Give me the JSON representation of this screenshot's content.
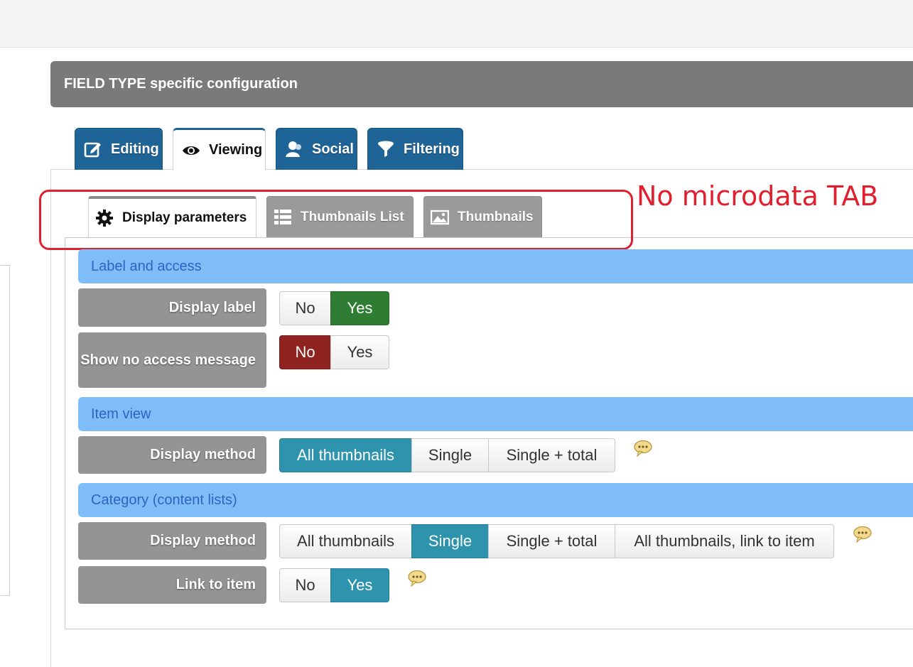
{
  "header": {
    "title": "FIELD TYPE specific configuration"
  },
  "main_tabs": [
    {
      "label": "Editing",
      "icon": "edit-icon",
      "active": false
    },
    {
      "label": "Viewing",
      "icon": "eye-icon",
      "active": true
    },
    {
      "label": "Social",
      "icon": "users-icon",
      "active": false
    },
    {
      "label": "Filtering",
      "icon": "filter-icon",
      "active": false
    }
  ],
  "sub_tabs": [
    {
      "label": "Display parameters",
      "icon": "gear-icon",
      "active": true
    },
    {
      "label": "Thumbnails List",
      "icon": "list-icon",
      "active": false
    },
    {
      "label": "Thumbnails",
      "icon": "image-icon",
      "active": false
    }
  ],
  "annotation": {
    "text": "No microdata TAB",
    "color": "#e0202e"
  },
  "sections": {
    "label_access": {
      "title": "Label and access",
      "display_label": {
        "label": "Display label",
        "options": [
          "No",
          "Yes"
        ],
        "selected": "Yes"
      },
      "show_no_access": {
        "label": "Show no access message",
        "options": [
          "No",
          "Yes"
        ],
        "selected": "No"
      }
    },
    "item_view": {
      "title": "Item view",
      "display_method": {
        "label": "Display method",
        "options": [
          "All thumbnails",
          "Single",
          "Single + total"
        ],
        "selected": "All thumbnails"
      }
    },
    "category": {
      "title": "Category (content lists)",
      "display_method": {
        "label": "Display method",
        "options": [
          "All thumbnails",
          "Single",
          "Single + total",
          "All thumbnails, link to item"
        ],
        "selected": "Single"
      },
      "link_to_item": {
        "label": "Link to item",
        "options": [
          "No",
          "Yes"
        ],
        "selected": "Yes"
      }
    }
  },
  "colors": {
    "tab_blue": "#1f6496",
    "section_blue": "#7fbdf8",
    "yes_green": "#2f7d32",
    "no_red": "#8e2320",
    "selected_teal": "#2e93ad"
  }
}
